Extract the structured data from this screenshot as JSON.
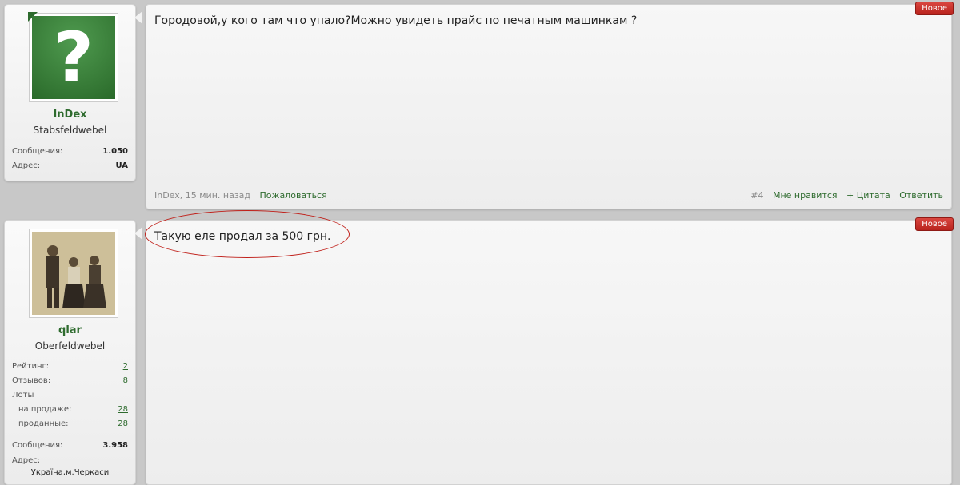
{
  "posts": [
    {
      "user": {
        "name": "InDex",
        "title": "Stabsfeldwebel",
        "messages_label": "Сообщения:",
        "messages": "1.050",
        "address_label": "Адрес:",
        "address": "UA"
      },
      "badge": "Новое",
      "text": "Городовой,у кого там что упало?Можно увидеть прайс по печатным машинкам ?",
      "footer": {
        "meta": "InDex, 15 мин. назад",
        "report": "Пожаловаться",
        "number": "#4",
        "like": "Мне нравится",
        "quote": "+ Цитата",
        "reply": "Ответить"
      }
    },
    {
      "user": {
        "name": "qlar",
        "title": "Oberfeldwebel",
        "rating_label": "Рейтинг:",
        "rating": "2",
        "reviews_label": "Отзывов:",
        "reviews": "8",
        "lots_label": "Лоты",
        "on_sale_label": "на продаже:",
        "on_sale": "28",
        "sold_label": "проданные:",
        "sold": "28",
        "messages_label": "Сообщения:",
        "messages": "3.958",
        "address_label": "Адрес:",
        "address": "Україна,м.Черкаси"
      },
      "badge": "Новое",
      "text": "Такую еле продал за 500 грн."
    }
  ]
}
